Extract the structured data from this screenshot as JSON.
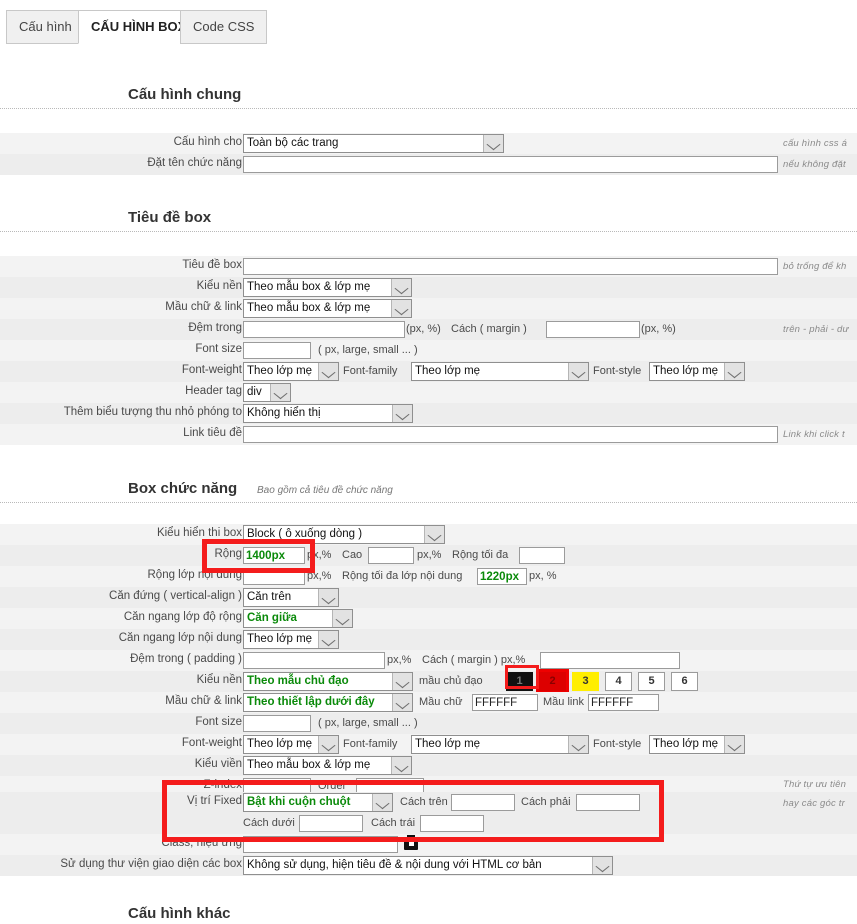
{
  "tabs": [
    {
      "label": "Cấu hình",
      "active": false
    },
    {
      "label": "CẤU HÌNH BOX",
      "active": true
    },
    {
      "label": "Code CSS",
      "active": false
    }
  ],
  "sections": {
    "general": {
      "title": "Cấu hình chung",
      "subtitle": ""
    },
    "boxtitle": {
      "title": "Tiêu đề box",
      "subtitle": ""
    },
    "boxfunc": {
      "title": "Box chức năng",
      "subtitle": "Bao gồm cả tiêu đề chức năng"
    },
    "other": {
      "title": "Cấu hình khác",
      "subtitle": ""
    }
  },
  "general": {
    "config_for_label": "Cấu hình cho",
    "config_for_value": "Toàn bộ các trang",
    "name_label": "Đặt tên chức năng",
    "name_value": "",
    "hint1": "cấu hình css á",
    "hint2": "nếu không đặt"
  },
  "boxtitle": {
    "title_label": "Tiêu đề box",
    "title_value": "",
    "bg_label": "Kiểu nền",
    "bg_value": "Theo mẫu box & lớp mẹ",
    "color_label": "Mầu chữ & link",
    "color_value": "Theo mẫu box & lớp mẹ",
    "padding_label": "Đệm trong",
    "padding_value": "",
    "padding_unit": "(px, %)",
    "margin_label": "Cách ( margin )",
    "margin_value": "",
    "margin_unit": "(px, %)",
    "fontsize_label": "Font size",
    "fontsize_value": "",
    "fontsize_unit": "( px, large, small ... )",
    "fontweight_label": "Font-weight",
    "fontweight_value": "Theo lớp mẹ",
    "fontfamily_label": "Font-family",
    "fontfamily_value": "Theo lớp mẹ",
    "fontstyle_label": "Font-style",
    "fontstyle_value": "Theo lớp mẹ",
    "headertag_label": "Header tag",
    "headertag_value": "div",
    "zoomicon_label": "Thêm biểu tượng thu nhỏ phóng to",
    "zoomicon_value": "Không hiển thị",
    "link_label": "Link tiêu đề",
    "link_value": "",
    "hint_title": "bỏ trống để kh",
    "hint_padding": "trên - phải - dư",
    "hint_link": "Link khi click t"
  },
  "boxfunc": {
    "display_label": "Kiểu hiển thi box",
    "display_value": "Block ( ô xuống dòng )",
    "width_label": "Rộng",
    "width_value": "1400px",
    "width_unit": "px,%",
    "height_label": "Cao",
    "height_value": "",
    "height_unit": "px,%",
    "maxwidth_label": "Rộng tối đa",
    "maxwidth_value": "",
    "innerwidth_label": "Rộng lớp nội dung",
    "innerwidth_value": "",
    "innerwidth_unit": "px,%",
    "innermax_label": "Rộng tối đa lớp nội dung",
    "innermax_value": "1220px",
    "innermax_unit": "px, %",
    "valign_label": "Căn đứng ( vertical-align )",
    "valign_value": "Căn trên",
    "halign_width_label": "Căn ngang lớp độ rộng",
    "halign_width_value": "Căn giữa",
    "halign_content_label": "Căn ngang lớp nội dung",
    "halign_content_value": "Theo lớp mẹ",
    "padding_label": "Đệm trong ( padding )",
    "padding_value": "",
    "padding_unit": "px,%",
    "margin_label": "Cách ( margin ) px,%",
    "margin_value": "",
    "bg_label": "Kiểu nền",
    "bg_value": "Theo mẫu chủ đạo",
    "maincolor_label": "mầu chủ đạo",
    "swatches": [
      {
        "label": "1",
        "bg": "#111111",
        "fg": "#777777",
        "selected": false
      },
      {
        "label": "2",
        "bg": "#dd0000",
        "fg": "#8a0000",
        "selected": true
      },
      {
        "label": "3",
        "bg": "#ffee00",
        "fg": "#333333",
        "selected": false
      },
      {
        "label": "4",
        "bg": "#ffffff",
        "fg": "#333333",
        "selected": false
      },
      {
        "label": "5",
        "bg": "#ffffff",
        "fg": "#333333",
        "selected": false
      },
      {
        "label": "6",
        "bg": "#ffffff",
        "fg": "#333333",
        "selected": false
      }
    ],
    "textcolor_label": "Mầu chữ & link",
    "textcolor_value": "Theo thiết lập dưới đây",
    "fontcolor_label": "Mầu chữ",
    "fontcolor_value": "FFFFFF",
    "linkcolor_label": "Mầu link",
    "linkcolor_value": "FFFFFF",
    "fontsize_label": "Font size",
    "fontsize_value": "",
    "fontsize_unit": "( px, large, small ... )",
    "fontweight_label": "Font-weight",
    "fontweight_value": "Theo lớp mẹ",
    "fontfamily_label": "Font-family",
    "fontfamily_value": "Theo lớp mẹ",
    "fontstyle_label": "Font-style",
    "fontstyle_value": "Theo lớp mẹ",
    "border_label": "Kiểu viền",
    "border_value": "Theo mẫu box & lớp mẹ",
    "zindex_label": "Z-index",
    "zindex_value": "",
    "order_label": "Order",
    "order_value": "",
    "fixed_label": "Vị trí Fixed",
    "fixed_value": "Bật khi cuộn chuột",
    "top_label": "Cách trên",
    "top_value": "",
    "right_label": "Cách phải",
    "right_value": "",
    "bottom_label": "Cách dưới",
    "bottom_value": "",
    "left_label": "Cách trái",
    "left_value": "",
    "class_label": "Class, hiệu ứng",
    "class_value": "",
    "lib_label": "Sử dụng thư viện giao diện các box",
    "lib_value": "Không sử dụng, hiện tiêu đề & nội dung với HTML cơ bản",
    "hint_zindex": "Thứ tự ưu tiên",
    "hint_fixed": "hay các góc tr"
  },
  "colors": {
    "highlight_red": "#f41c1c",
    "value_green": "#0a8a0a"
  }
}
